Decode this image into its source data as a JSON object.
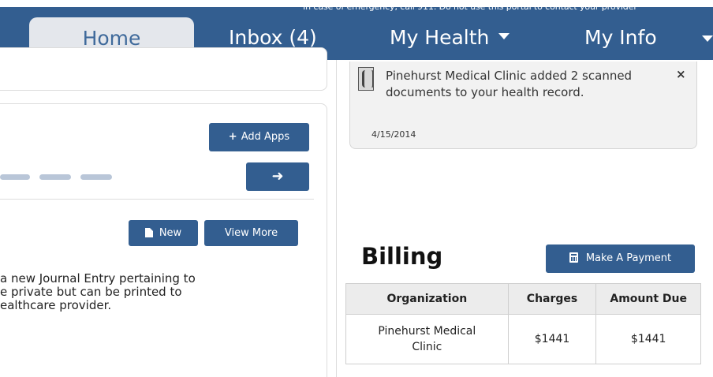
{
  "header": {
    "emergency_notice": "In case of emergency, call 911. Do not use this portal to contact your provider",
    "tabs": [
      {
        "label": "Home",
        "active": true
      },
      {
        "label": "Inbox (4)"
      },
      {
        "label": "My Health"
      },
      {
        "label": "My Info"
      }
    ]
  },
  "apps": {
    "add_apps_label": "Add Apps",
    "next_arrow": "➜"
  },
  "journal": {
    "new_label": "New",
    "view_more_label": "View More",
    "lines": [
      "a new Journal Entry pertaining to",
      "e private but can be printed to",
      "ealthcare provider."
    ]
  },
  "notification": {
    "text": "Pinehurst Medical Clinic added 2 scanned documents to your health record.",
    "date": "4/15/2014",
    "close": "×"
  },
  "billing": {
    "title": "Billing",
    "pay_label": "Make A Payment",
    "columns": [
      "Organization",
      "Charges",
      "Amount Due"
    ],
    "rows": [
      {
        "organization": "Pinehurst Medical Clinic",
        "charges": "$1441",
        "amount_due": "$1441"
      }
    ]
  },
  "colors": {
    "brand": "#335e90",
    "tab_active_bg": "#e4e7ec"
  }
}
